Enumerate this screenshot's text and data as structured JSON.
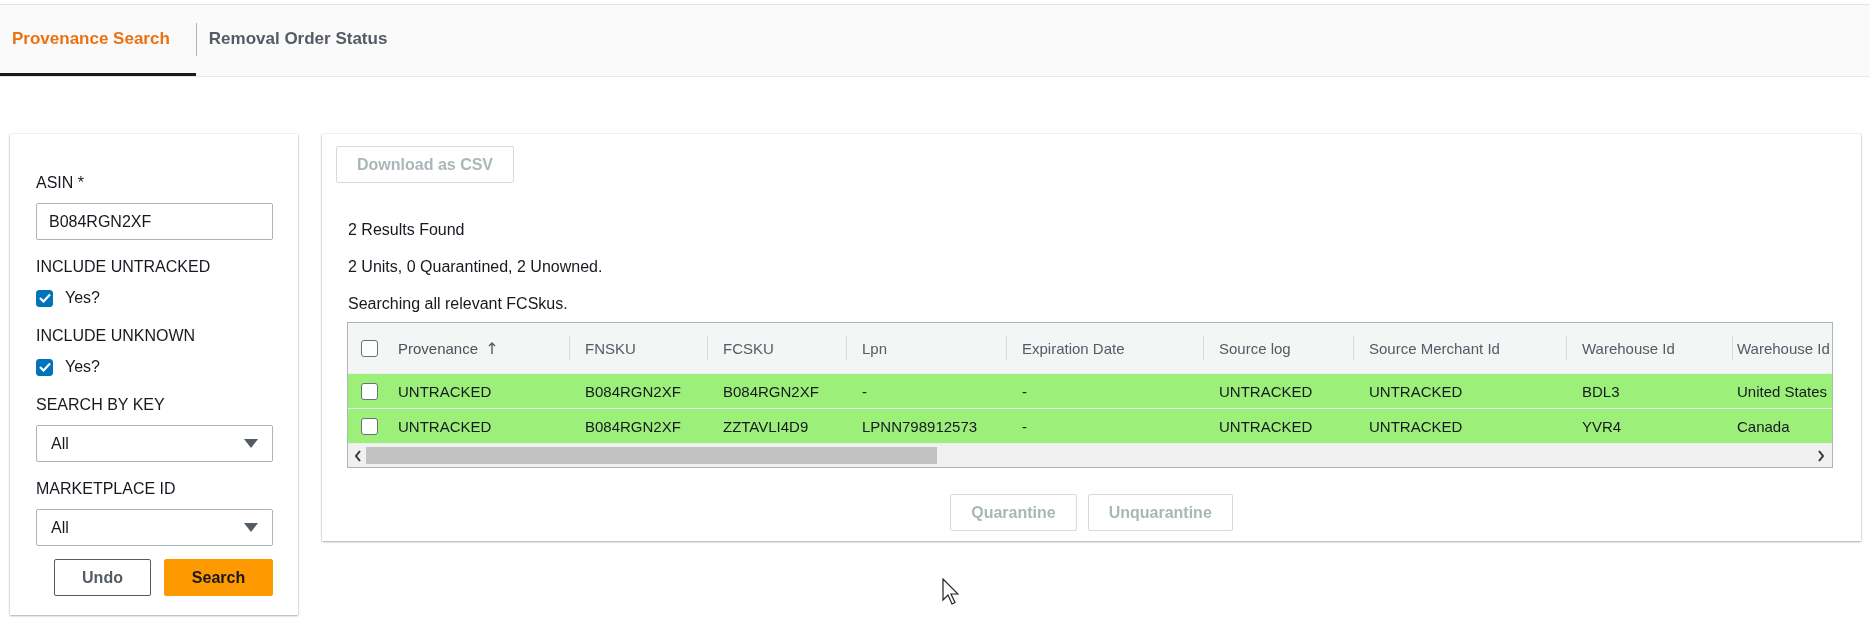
{
  "tabs": [
    {
      "label": "Provenance Search",
      "selected": true
    },
    {
      "label": "Removal Order Status",
      "selected": false
    }
  ],
  "form": {
    "asin": {
      "label": "ASIN *",
      "value": "B084RGN2XF"
    },
    "include_untracked": {
      "label": "INCLUDE UNTRACKED",
      "option": "Yes?",
      "checked": true
    },
    "include_unknown": {
      "label": "INCLUDE UNKNOWN",
      "option": "Yes?",
      "checked": true
    },
    "search_by_key": {
      "label": "SEARCH BY KEY",
      "value": "All"
    },
    "marketplace_id": {
      "label": "MARKETPLACE ID",
      "value": "All"
    },
    "buttons": [
      {
        "label": "Undo",
        "kind": "secondary"
      },
      {
        "label": "Search",
        "kind": "primary"
      }
    ]
  },
  "results": {
    "download_button": {
      "label": "Download as CSV",
      "disabled": true
    },
    "summary": [
      "2 Results Found",
      "2 Units, 0 Quarantined, 2 Unowned.",
      "Searching all relevant FCSkus."
    ],
    "table": {
      "select_all": {
        "checked": false
      },
      "columns": [
        {
          "label": "Provenance",
          "sorted": true
        },
        {
          "label": "FNSKU",
          "sorted": false
        },
        {
          "label": "FCSKU",
          "sorted": false
        },
        {
          "label": "Lpn",
          "sorted": false
        },
        {
          "label": "Expiration Date",
          "sorted": false
        },
        {
          "label": "Source log",
          "sorted": false
        },
        {
          "label": "Source Merchant Id",
          "sorted": false
        },
        {
          "label": "Warehouse Id",
          "sorted": false
        },
        {
          "label": "Warehouse Id"
        }
      ],
      "rows": [
        {
          "checked": false,
          "highlighted": true,
          "cells": [
            "UNTRACKED",
            "B084RGN2XF",
            "B084RGN2XF",
            "-",
            "-",
            "UNTRACKED",
            "UNTRACKED",
            "BDL3",
            "United States"
          ]
        },
        {
          "checked": false,
          "highlighted": true,
          "cells": [
            "UNTRACKED",
            "B084RGN2XF",
            "ZZTAVLI4D9",
            "LPNN798912573",
            "-",
            "UNTRACKED",
            "UNTRACKED",
            "YVR4",
            "Canada"
          ]
        }
      ]
    },
    "actions": [
      {
        "label": "Quarantine",
        "disabled": true
      },
      {
        "label": "Unquarantine",
        "disabled": true
      }
    ]
  }
}
